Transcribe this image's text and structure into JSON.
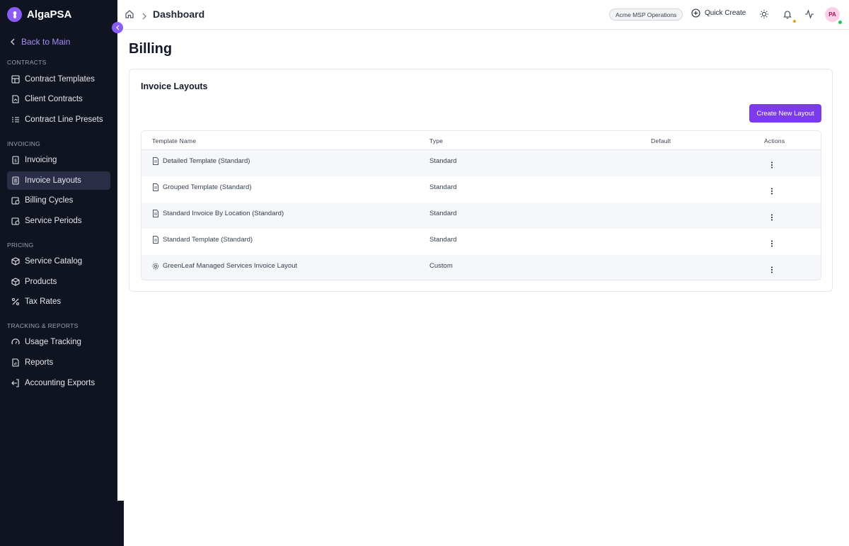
{
  "brand": {
    "name": "AlgaPSA"
  },
  "sidebar": {
    "back_label": "Back to Main",
    "sections": [
      {
        "label": "CONTRACTS",
        "items": [
          "Contract Templates",
          "Client Contracts",
          "Contract Line Presets"
        ]
      },
      {
        "label": "INVOICING",
        "items": [
          "Invoicing",
          "Invoice Layouts",
          "Billing Cycles",
          "Service Periods"
        ]
      },
      {
        "label": "PRICING",
        "items": [
          "Service Catalog",
          "Products",
          "Tax Rates"
        ]
      },
      {
        "label": "TRACKING & REPORTS",
        "items": [
          "Usage Tracking",
          "Reports",
          "Accounting Exports"
        ]
      }
    ],
    "active_item": "Invoice Layouts"
  },
  "header": {
    "breadcrumb_title": "Dashboard",
    "org_badge": "Acme MSP Operations",
    "quick_create": "Quick Create",
    "avatar_initials": "PA"
  },
  "main": {
    "page_title": "Billing",
    "card_title": "Invoice Layouts",
    "create_button": "Create New Layout",
    "table": {
      "columns": [
        "Template Name",
        "Type",
        "Default",
        "Actions"
      ],
      "rows": [
        {
          "name": "Detailed Template (Standard)",
          "type": "Standard",
          "icon": "document-icon"
        },
        {
          "name": "Grouped Template (Standard)",
          "type": "Standard",
          "icon": "document-icon"
        },
        {
          "name": "Standard Invoice By Location (Standard)",
          "type": "Standard",
          "icon": "document-icon"
        },
        {
          "name": "Standard Template (Standard)",
          "type": "Standard",
          "icon": "document-icon"
        },
        {
          "name": "GreenLeaf Managed Services Invoice Layout",
          "type": "Custom",
          "icon": "gear-icon"
        }
      ]
    }
  },
  "colors": {
    "sidebar_bg": "#0f1420",
    "accent": "#7c3aed",
    "active_item_bg": "#2a2d45"
  }
}
